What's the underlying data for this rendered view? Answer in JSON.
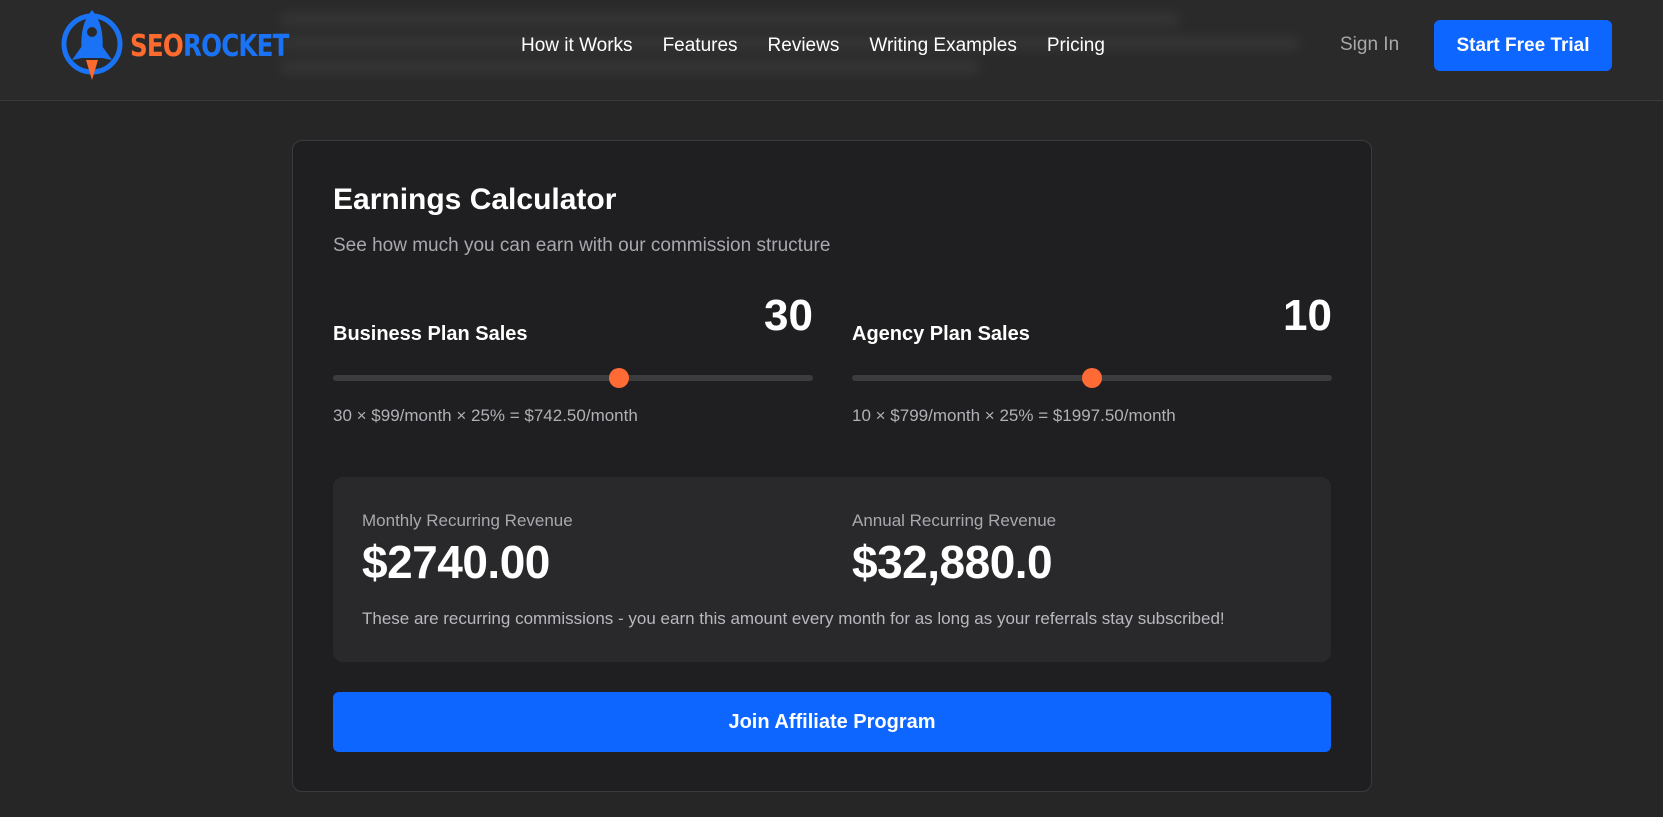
{
  "header": {
    "logo": {
      "seo": "SEO",
      "rocket": "ROCKET"
    },
    "nav": [
      "How it Works",
      "Features",
      "Reviews",
      "Writing Examples",
      "Pricing"
    ],
    "sign_in": "Sign In",
    "cta": "Start Free Trial"
  },
  "calculator": {
    "title": "Earnings Calculator",
    "subtitle": "See how much you can earn with our commission structure",
    "business": {
      "label": "Business Plan Sales",
      "value": "30",
      "slider_fraction": 0.595,
      "formula": "30 × $99/month × 25% = $742.50/month"
    },
    "agency": {
      "label": "Agency Plan Sales",
      "value": "10",
      "slider_fraction": 0.5,
      "formula": "10 × $799/month × 25% = $1997.50/month"
    },
    "monthly": {
      "label": "Monthly Recurring Revenue",
      "value": "$2740.00"
    },
    "annual": {
      "label": "Annual Recurring Revenue",
      "value": "$32,880.0"
    },
    "note": "These are recurring commissions - you earn this amount every month for as long as your referrals stay subscribed!",
    "join": "Join Affiliate Program"
  },
  "colors": {
    "accent_blue": "#0d66ff",
    "accent_orange": "#ff6a35",
    "background": "#262626",
    "card": "#1f1f21"
  }
}
